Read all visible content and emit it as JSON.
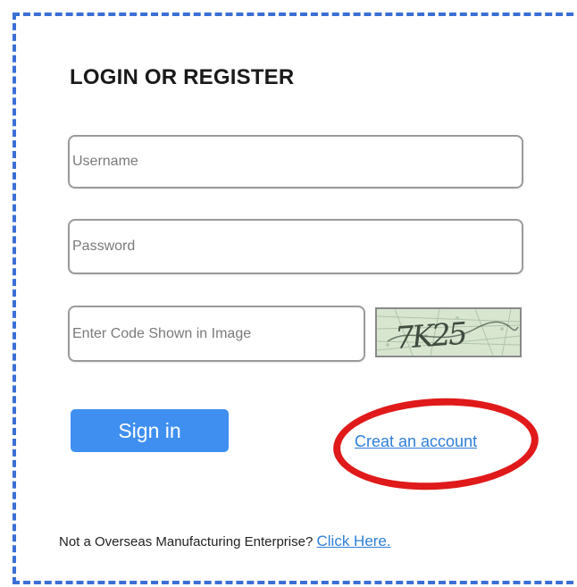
{
  "form": {
    "title": "LOGIN OR REGISTER",
    "username_placeholder": "Username",
    "password_placeholder": "Password",
    "captcha_placeholder": "Enter Code Shown in Image",
    "captcha_image_text": "7K25",
    "signin_label": "Sign in",
    "create_account_label": "Creat an account",
    "footer_text": "Not a Overseas Manufacturing Enterprise?",
    "footer_link_label": "Click Here."
  },
  "colors": {
    "accent_blue": "#3f8ff0",
    "link_blue": "#2f7fd8",
    "highlight_red": "#e01a1a",
    "frame_blue": "#3b6fd6"
  }
}
